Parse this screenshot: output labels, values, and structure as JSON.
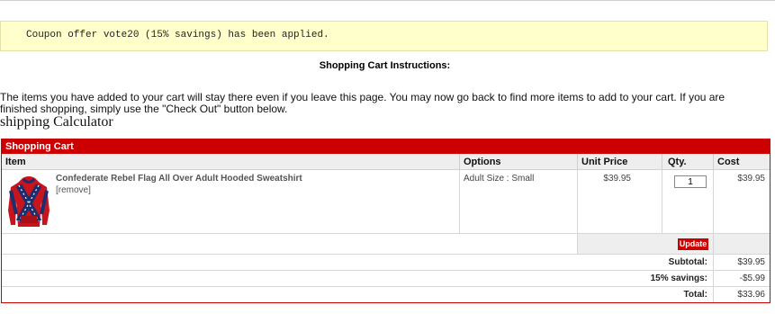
{
  "coupon": {
    "message": "Coupon offer vote20 (15% savings) has been applied."
  },
  "instructions": {
    "title": "Shopping Cart Instructions:",
    "body": "The items you have added to your cart will stay there even if you leave this page. You may now go back to find more items to add to your cart. If you are finished shopping, simply use the \"Check Out\" button below."
  },
  "calculator": {
    "title": "shipping Calculator"
  },
  "cart": {
    "title": "Shopping Cart",
    "columns": {
      "item": "Item",
      "options": "Options",
      "unit_price": "Unit Price",
      "qty": "Qty.",
      "cost": "Cost"
    },
    "items": [
      {
        "name": "Confederate Rebel Flag All Over Adult Hooded Sweatshirt",
        "remove_label": "[remove]",
        "options": "Adult Size : Small",
        "unit_price": "$39.95",
        "qty": "1",
        "cost": "$39.95",
        "image_icon": "hoodie-image"
      }
    ],
    "update_label": "Update",
    "summary": {
      "subtotal_label": "Subtotal:",
      "subtotal_value": "$39.95",
      "savings_label": "15% savings:",
      "savings_value": "-$5.99",
      "total_label": "Total:",
      "total_value": "$33.96"
    },
    "colors": {
      "accent": "#cc0000",
      "notice_bg": "#ffffcc",
      "header_bg": "#eeeeee"
    }
  }
}
